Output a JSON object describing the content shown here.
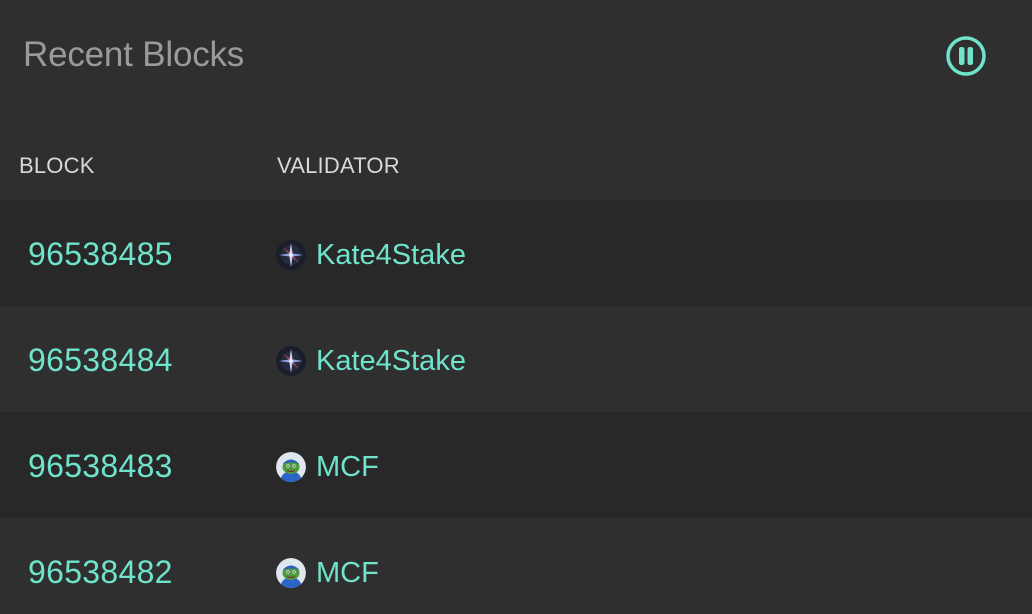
{
  "header": {
    "title": "Recent Blocks",
    "pause_icon": "pause-circle-icon",
    "accent_color": "#6fe3cc"
  },
  "table": {
    "columns": [
      "BLOCK",
      "VALIDATOR"
    ],
    "rows": [
      {
        "block": "96538485",
        "validator": "Kate4Stake",
        "avatar_icon": "kate4stake-avatar-icon"
      },
      {
        "block": "96538484",
        "validator": "Kate4Stake",
        "avatar_icon": "kate4stake-avatar-icon"
      },
      {
        "block": "96538483",
        "validator": "MCF",
        "avatar_icon": "mcf-avatar-icon"
      },
      {
        "block": "96538482",
        "validator": "MCF",
        "avatar_icon": "mcf-avatar-icon"
      }
    ]
  }
}
